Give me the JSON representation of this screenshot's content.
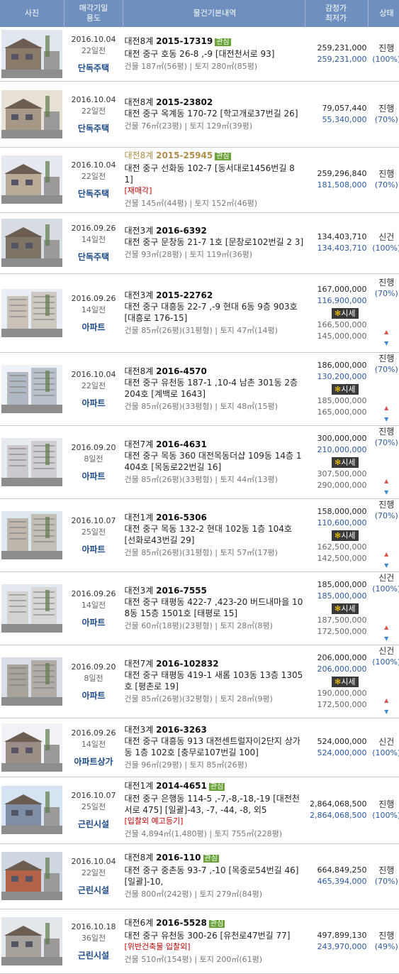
{
  "header": {
    "photo": "사진",
    "date_use_1": "매각기일",
    "date_use_2": "용도",
    "info": "물건기본내역",
    "price_1": "감정가",
    "price_2": "최저가",
    "status": "상태"
  },
  "labels": {
    "tag": "관심",
    "market": "시세",
    "up": "▲",
    "down": "▼"
  },
  "rows": [
    {
      "date": "2016.10.04",
      "dday": "22일전",
      "use": "단독주택",
      "court": "대전8계",
      "caseno": "2015-17319",
      "tag": true,
      "addr": "대전 중구 호동 26-8 ,-9 [대전천서로 93]",
      "warn": "",
      "area": "건물 187㎡(56평) | 토지 280㎡(85평)",
      "appraised": "259,231,000",
      "minimum": "259,231,000",
      "status": "진행",
      "pct": "(100%)",
      "market_hi": "",
      "market_lo": ""
    },
    {
      "date": "2016.10.04",
      "dday": "22일전",
      "use": "단독주택",
      "court": "대전8계",
      "caseno": "2015-23802",
      "tag": false,
      "addr": "대전 중구 옥계동 170-72 [학고개로37번길 26]",
      "warn": "",
      "area": "건물 76㎡(23평) | 토지 129㎡(39평)",
      "appraised": "79,057,440",
      "minimum": "55,340,000",
      "status": "진행",
      "pct": "(70%)",
      "market_hi": "",
      "market_lo": ""
    },
    {
      "date": "2016.10.04",
      "dday": "22일전",
      "use": "단독주택",
      "court": "대전8계",
      "caseno": "2015-25945",
      "tag": true,
      "addr": "대전 중구 선화동 102-7 [동서대로1456번길 8 1]",
      "warn": "[재매각]",
      "area": "건물 145㎡(44평) | 토지 152㎡(46평)",
      "appraised": "259,296,840",
      "minimum": "181,508,000",
      "status": "진행",
      "pct": "(70%)",
      "market_hi": "",
      "market_lo": ""
    },
    {
      "date": "2016.09.26",
      "dday": "14일전",
      "use": "단독주택",
      "court": "대전3계",
      "caseno": "2016-6392",
      "tag": false,
      "addr": "대전 중구 문창동 21-7 1호 [문창로102번길 2 3]",
      "warn": "",
      "area": "건물 93㎡(28평) | 토지 119㎡(36평)",
      "appraised": "134,403,710",
      "minimum": "134,403,710",
      "status": "신건",
      "pct": "(100%)",
      "market_hi": "",
      "market_lo": ""
    },
    {
      "date": "2016.09.26",
      "dday": "14일전",
      "use": "아파트",
      "court": "대전3계",
      "caseno": "2015-22762",
      "tag": false,
      "addr": "대전 중구 대흥동 22-7 ,-9 현대 6동 9층 903호 [대흥로 176-15]",
      "warn": "",
      "area": "건물 85㎡(26평)(31평형) | 토지 47㎡(14평)",
      "appraised": "167,000,000",
      "minimum": "116,900,000",
      "status": "진행",
      "pct": "(70%)",
      "market_hi": "166,500,000",
      "market_lo": "145,000,000"
    },
    {
      "date": "2016.10.04",
      "dday": "22일전",
      "use": "아파트",
      "court": "대전8계",
      "caseno": "2016-4570",
      "tag": false,
      "addr": "대전 중구 유천동 187-1 ,10-4 남촌 301동 2층 204호 [계백로 1643]",
      "warn": "",
      "area": "건물 85㎡(26평)(33평형) | 토지 48㎡(15평)",
      "appraised": "186,000,000",
      "minimum": "130,200,000",
      "status": "진행",
      "pct": "(70%)",
      "market_hi": "185,000,000",
      "market_lo": "165,000,000"
    },
    {
      "date": "2016.09.20",
      "dday": "8일전",
      "use": "아파트",
      "court": "대전7계",
      "caseno": "2016-4631",
      "tag": false,
      "addr": "대전 중구 목동 360 대전목동더샵 109동 14층 1404호 [목동로22번길 16]",
      "warn": "",
      "area": "건물 85㎡(26평)(33평형) | 토지 44㎡(13평)",
      "appraised": "300,000,000",
      "minimum": "210,000,000",
      "status": "진행",
      "pct": "(70%)",
      "market_hi": "307,500,000",
      "market_lo": "290,000,000"
    },
    {
      "date": "2016.10.07",
      "dday": "25일전",
      "use": "아파트",
      "court": "대전1계",
      "caseno": "2016-5306",
      "tag": false,
      "addr": "대전 중구 목동 132-2 현대 102동 1층 104호 [선화로43번길 29]",
      "warn": "",
      "area": "건물 85㎡(26평)(31평형) | 토지 57㎡(17평)",
      "appraised": "158,000,000",
      "minimum": "110,600,000",
      "status": "진행",
      "pct": "(70%)",
      "market_hi": "162,500,000",
      "market_lo": "142,500,000"
    },
    {
      "date": "2016.09.26",
      "dday": "14일전",
      "use": "아파트",
      "court": "대전3계",
      "caseno": "2016-7555",
      "tag": false,
      "addr": "대전 중구 태평동 422-7 ,423-20 버드내마을 108동 15층 1501호 [태평로 15]",
      "warn": "",
      "area": "건물 60㎡(18평)(23평형) | 토지 28㎡(8평)",
      "appraised": "185,000,000",
      "minimum": "185,000,000",
      "status": "신건",
      "pct": "(100%)",
      "market_hi": "187,500,000",
      "market_lo": "172,500,000"
    },
    {
      "date": "2016.09.20",
      "dday": "8일전",
      "use": "아파트",
      "court": "대전7계",
      "caseno": "2016-102832",
      "tag": false,
      "addr": "대전 중구 태평동 419-1 새롬 103동 13층 1305호 [평촌로 19]",
      "warn": "",
      "area": "건물 85㎡(26평)(32평형) | 토지 28㎡(9평)",
      "appraised": "206,000,000",
      "minimum": "206,000,000",
      "status": "신건",
      "pct": "(100%)",
      "market_hi": "190,000,000",
      "market_lo": "172,500,000"
    },
    {
      "date": "2016.09.26",
      "dday": "14일전",
      "use": "아파트상가",
      "court": "대전3계",
      "caseno": "2016-3263",
      "tag": false,
      "addr": "대전 중구 대흥동 913 대전센트럴자이2단지 상가동 1층 102호 [충무로107번길 100]",
      "warn": "",
      "area": "건물 96㎡(29평) | 토지 85㎡(26평)",
      "appraised": "524,000,000",
      "minimum": "524,000,000",
      "status": "신건",
      "pct": "(100%)",
      "market_hi": "",
      "market_lo": ""
    },
    {
      "date": "2016.10.07",
      "dday": "25일전",
      "use": "근린시설",
      "court": "대전1계",
      "caseno": "2014-4651",
      "tag": true,
      "addr": "대전 중구 은행동 114-5 ,-7,-8,-18,-19 [대전천서로 475] [일괄]-43, -7, -44, -8, 외5",
      "warn": "[입찰외 예고등기]",
      "area": "건물 4,894㎡(1,480평) | 토지 755㎡(228평)",
      "appraised": "2,864,068,500",
      "minimum": "2,864,068,500",
      "status": "진행",
      "pct": "(100%)",
      "market_hi": "",
      "market_lo": ""
    },
    {
      "date": "2016.10.04",
      "dday": "22일전",
      "use": "근린시설",
      "court": "대전8계",
      "caseno": "2016-110",
      "tag": true,
      "addr": "대전 중구 중촌동 93-7 ,-10 [목중로54번길 46] [일괄]-10,",
      "warn": "",
      "area": "건물 800㎡(242평) | 토지 279㎡(84평)",
      "appraised": "664,849,250",
      "minimum": "465,394,000",
      "status": "진행",
      "pct": "(70%)",
      "market_hi": "",
      "market_lo": ""
    },
    {
      "date": "2016.10.18",
      "dday": "36일전",
      "use": "근린시설",
      "court": "대전6계",
      "caseno": "2016-5528",
      "tag": true,
      "addr": "대전 중구 유천동 300-26 [유천로47번길 77]",
      "warn": "[위반건축물 입찰외]",
      "area": "건물 510㎡(154평) | 토지 200㎡(61평)",
      "appraised": "497,899,130",
      "minimum": "243,970,000",
      "status": "진행",
      "pct": "(49%)",
      "market_hi": "",
      "market_lo": ""
    }
  ]
}
